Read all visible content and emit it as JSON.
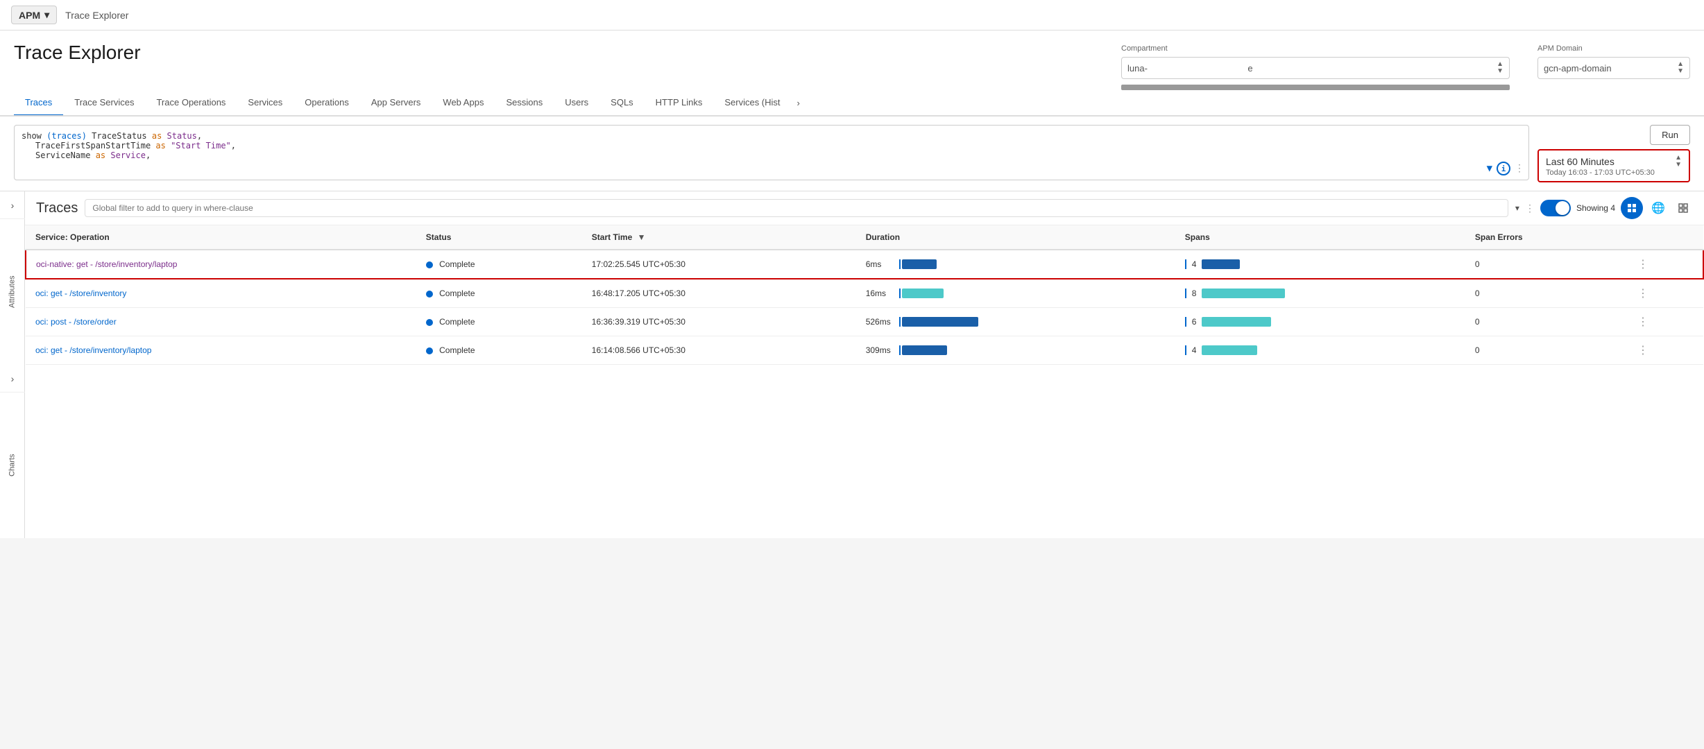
{
  "topbar": {
    "apm_label": "APM",
    "breadcrumb": "Trace Explorer"
  },
  "page": {
    "title": "Trace Explorer"
  },
  "compartment": {
    "label": "Compartment",
    "value": "luna-████████████████████████████████e",
    "display_text": "luna-                                        e"
  },
  "apm_domain": {
    "label": "APM Domain",
    "value": "gcn-apm-domain"
  },
  "tabs": [
    {
      "id": "traces",
      "label": "Traces",
      "active": true
    },
    {
      "id": "trace-services",
      "label": "Trace Services",
      "active": false
    },
    {
      "id": "trace-operations",
      "label": "Trace Operations",
      "active": false
    },
    {
      "id": "services",
      "label": "Services",
      "active": false
    },
    {
      "id": "operations",
      "label": "Operations",
      "active": false
    },
    {
      "id": "app-servers",
      "label": "App Servers",
      "active": false
    },
    {
      "id": "web-apps",
      "label": "Web Apps",
      "active": false
    },
    {
      "id": "sessions",
      "label": "Sessions",
      "active": false
    },
    {
      "id": "users",
      "label": "Users",
      "active": false
    },
    {
      "id": "sqls",
      "label": "SQLs",
      "active": false
    },
    {
      "id": "http-links",
      "label": "HTTP Links",
      "active": false
    },
    {
      "id": "services-hist",
      "label": "Services (Hist",
      "active": false
    }
  ],
  "query": {
    "line1": "show (traces) TraceStatus as Status,",
    "line2": "TraceFirstSpanStartTime as \"Start Time\",",
    "line3": "ServiceName as Service,",
    "run_label": "Run"
  },
  "time_selector": {
    "title": "Last 60 Minutes",
    "subtitle": "Today 16:03 - 17:03 UTC+05:30"
  },
  "traces_panel": {
    "title": "Traces",
    "filter_placeholder": "Global filter to add to query in where-clause",
    "showing_text": "Showing 4",
    "columns": [
      {
        "key": "service_operation",
        "label": "Service: Operation"
      },
      {
        "key": "status",
        "label": "Status"
      },
      {
        "key": "start_time",
        "label": "Start Time",
        "sort": "desc"
      },
      {
        "key": "duration",
        "label": "Duration"
      },
      {
        "key": "spans",
        "label": "Spans"
      },
      {
        "key": "span_errors",
        "label": "Span Errors"
      }
    ],
    "rows": [
      {
        "id": "row1",
        "service_operation": "oci-native: get - /store/inventory/laptop",
        "service_operation_color": "purple",
        "status": "Complete",
        "start_time": "17:02:25.545 UTC+05:30",
        "duration_text": "6ms",
        "duration_bar_width": 50,
        "duration_bar_type": "dark_blue",
        "spans": "4",
        "span_bar_width": 55,
        "span_bar_type": "dark_blue",
        "span_errors": "0",
        "highlighted": true
      },
      {
        "id": "row2",
        "service_operation": "oci: get - /store/inventory",
        "service_operation_color": "blue",
        "status": "Complete",
        "start_time": "16:48:17.205 UTC+05:30",
        "duration_text": "16ms",
        "duration_bar_width": 60,
        "duration_bar_type": "teal",
        "spans": "8",
        "span_bar_width": 120,
        "span_bar_type": "teal",
        "span_errors": "0",
        "highlighted": false
      },
      {
        "id": "row3",
        "service_operation": "oci: post - /store/order",
        "service_operation_color": "blue",
        "status": "Complete",
        "start_time": "16:36:39.319 UTC+05:30",
        "duration_text": "526ms",
        "duration_bar_width": 110,
        "duration_bar_type": "dark_blue",
        "spans": "6",
        "span_bar_width": 100,
        "span_bar_type": "teal",
        "span_errors": "0",
        "highlighted": false
      },
      {
        "id": "row4",
        "service_operation": "oci: get - /store/inventory/laptop",
        "service_operation_color": "blue",
        "status": "Complete",
        "start_time": "16:14:08.566 UTC+05:30",
        "duration_text": "309ms",
        "duration_bar_width": 65,
        "duration_bar_type": "dark_blue",
        "spans": "4",
        "span_bar_width": 80,
        "span_bar_type": "teal",
        "span_errors": "0",
        "highlighted": false
      }
    ]
  },
  "side_panel": {
    "attributes_label": "Attributes",
    "charts_label": "Charts"
  }
}
